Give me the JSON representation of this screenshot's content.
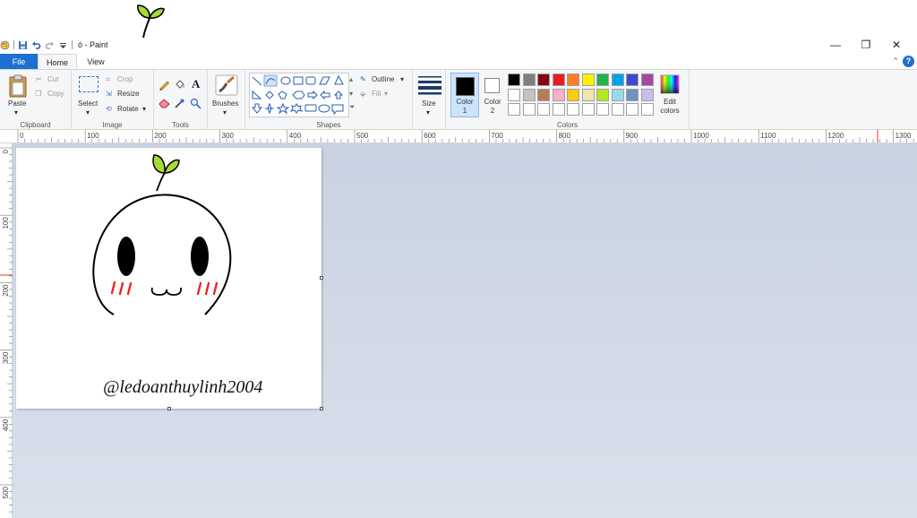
{
  "titlebar": {
    "title": "ó - Paint",
    "qat_icons": [
      "paint-app-icon",
      "save-icon",
      "undo-icon",
      "redo-icon",
      "customize-qat-icon"
    ],
    "window_controls": {
      "minimize": "—",
      "restore": "❐",
      "close": "✕"
    }
  },
  "tabs": {
    "file": "File",
    "home": "Home",
    "view": "View",
    "active": "Home"
  },
  "ribbon": {
    "clipboard": {
      "group": "Clipboard",
      "paste": "Paste",
      "cut": "Cut",
      "copy": "Copy"
    },
    "image": {
      "group": "Image",
      "select": "Select",
      "crop": "Crop",
      "resize": "Resize",
      "rotate": "Rotate"
    },
    "tools": {
      "group": "Tools",
      "icons": [
        "pencil-icon",
        "fill-bucket-icon",
        "text-icon",
        "eraser-icon",
        "color-picker-icon",
        "magnifier-icon"
      ]
    },
    "brushes": {
      "label": "Brushes"
    },
    "shapes": {
      "group": "Shapes",
      "outline": "Outline",
      "fill": "Fill"
    },
    "size": {
      "label": "Size"
    },
    "colors": {
      "group": "Colors",
      "color1": "Color 1",
      "color2": "Color 2",
      "color1_value": "#000000",
      "color2_value": "#ffffff",
      "edit_colors": "Edit colors",
      "palette_row1": [
        "#000000",
        "#7f7f7f",
        "#880015",
        "#ed1c24",
        "#ff7f27",
        "#fff200",
        "#22b14c",
        "#00a2e8",
        "#3f48cc",
        "#a349a4"
      ],
      "palette_row2": [
        "#ffffff",
        "#c3c3c3",
        "#b97a57",
        "#ffaec9",
        "#ffc90e",
        "#efe4b0",
        "#b5e61d",
        "#99d9ea",
        "#7092be",
        "#c8bfe7"
      ],
      "palette_row3": [
        "#ffffff",
        "#ffffff",
        "#ffffff",
        "#ffffff",
        "#ffffff",
        "#ffffff",
        "#ffffff",
        "#ffffff",
        "#ffffff",
        "#ffffff"
      ]
    }
  },
  "rulers": {
    "horizontal_labels": [
      "0",
      "100",
      "200",
      "300",
      "400",
      "500",
      "600",
      "700",
      "800",
      "900",
      "1000",
      "1100",
      "1200",
      "1300"
    ],
    "vertical_labels": [
      "0",
      "100",
      "200",
      "300",
      "400",
      "500"
    ]
  },
  "canvas": {
    "watermark": "@ledoanthuylinh2004",
    "leaf_color": "#a6d93a",
    "blush_color": "#e8262b"
  }
}
